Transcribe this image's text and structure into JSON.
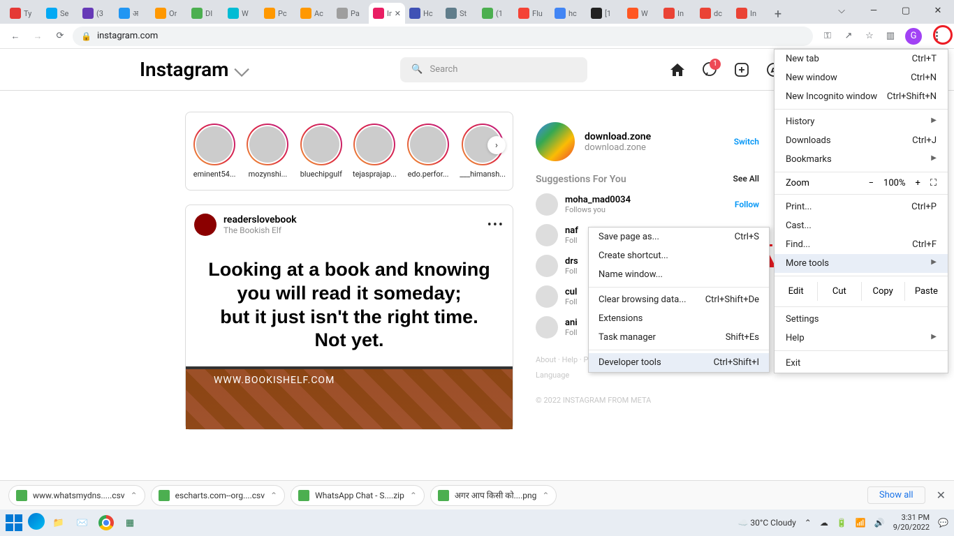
{
  "browser": {
    "tabs": [
      {
        "label": "Ty",
        "color": "#e53935"
      },
      {
        "label": "Se",
        "color": "#03a9f4"
      },
      {
        "label": "(3",
        "color": "#673ab7"
      },
      {
        "label": "अ",
        "color": "#2196f3"
      },
      {
        "label": "Or",
        "color": "#ff9800"
      },
      {
        "label": "DI",
        "color": "#4caf50"
      },
      {
        "label": "W",
        "color": "#00bcd4"
      },
      {
        "label": "Pc",
        "color": "#ff9800"
      },
      {
        "label": "Ac",
        "color": "#ff9800"
      },
      {
        "label": "Pa",
        "color": "#9e9e9e"
      },
      {
        "label": "In",
        "color": "#e91e63",
        "active": true
      },
      {
        "label": "Hc",
        "color": "#3f51b5"
      },
      {
        "label": "St",
        "color": "#607d8b"
      },
      {
        "label": "(1",
        "color": "#4caf50"
      },
      {
        "label": "Flu",
        "color": "#f44336"
      },
      {
        "label": "hc",
        "color": "#4285f4"
      },
      {
        "label": "[1",
        "color": "#212121"
      },
      {
        "label": "W",
        "color": "#ff5722"
      },
      {
        "label": "In",
        "color": "#ea4335"
      },
      {
        "label": "dc",
        "color": "#ea4335"
      },
      {
        "label": "In",
        "color": "#ea4335"
      }
    ],
    "url": "instagram.com",
    "profile_letter": "G"
  },
  "win": {
    "v": "⌵",
    "min": "—",
    "max": "▢",
    "close": "✕"
  },
  "ig": {
    "logo": "Instagram",
    "search_placeholder": "Search",
    "badge": "1",
    "stories": [
      "eminent54...",
      "mozynshi...",
      "bluechipgulf",
      "tejasprajap...",
      "edo.perfor...",
      "___himansh..."
    ],
    "post": {
      "user": "readerslovebook",
      "sub": "The Bookish Elf",
      "text": "Looking at a book and knowing you will read it someday;\nbut it just isn't the right time. Not yet.",
      "watermark": "WWW.BOOKISHELF.COM"
    },
    "me": {
      "name": "download.zone",
      "sub": "download.zone",
      "switch": "Switch"
    },
    "sugg_title": "Suggestions For You",
    "see_all": "See All",
    "suggestions": [
      {
        "name": "moha_mad0034",
        "sub": "Follows you",
        "follow": "Follow"
      },
      {
        "name": "naf",
        "sub": "Foll",
        "follow": ""
      },
      {
        "name": "drs",
        "sub": "Foll",
        "follow": ""
      },
      {
        "name": "cul",
        "sub": "Foll",
        "follow": ""
      },
      {
        "name": "ani",
        "sub": "Foll",
        "follow": ""
      }
    ],
    "footer_links": "About · Help · Press · API · Jobs · Privacy · Terms · Locations · Language",
    "footer_copy": "© 2022 INSTAGRAM FROM META"
  },
  "ctx": {
    "save": "Save page as...",
    "save_k": "Ctrl+S",
    "shortcut": "Create shortcut...",
    "name": "Name window...",
    "clear": "Clear browsing data...",
    "clear_k": "Ctrl+Shift+De",
    "ext": "Extensions",
    "task": "Task manager",
    "task_k": "Shift+Es",
    "dev": "Developer tools",
    "dev_k": "Ctrl+Shift+I"
  },
  "menu": {
    "newtab": "New tab",
    "newtab_k": "Ctrl+T",
    "newwin": "New window",
    "newwin_k": "Ctrl+N",
    "incog": "New Incognito window",
    "incog_k": "Ctrl+Shift+N",
    "history": "History",
    "downloads": "Downloads",
    "downloads_k": "Ctrl+J",
    "bookmarks": "Bookmarks",
    "zoom": "Zoom",
    "zoom_val": "100%",
    "print": "Print...",
    "print_k": "Ctrl+P",
    "cast": "Cast...",
    "find": "Find...",
    "find_k": "Ctrl+F",
    "more": "More tools",
    "edit": "Edit",
    "cut": "Cut",
    "copy": "Copy",
    "paste": "Paste",
    "settings": "Settings",
    "help": "Help",
    "exit": "Exit"
  },
  "downloads": [
    {
      "name": "www.whatsmydns.....csv"
    },
    {
      "name": "escharts.com--org....csv"
    },
    {
      "name": "WhatsApp Chat - S....zip"
    },
    {
      "name": "अगर आप किसी को....png"
    }
  ],
  "showall": "Show all",
  "tb": {
    "weather": "30°C Cloudy",
    "time": "3:31 PM",
    "date": "9/20/2022"
  }
}
